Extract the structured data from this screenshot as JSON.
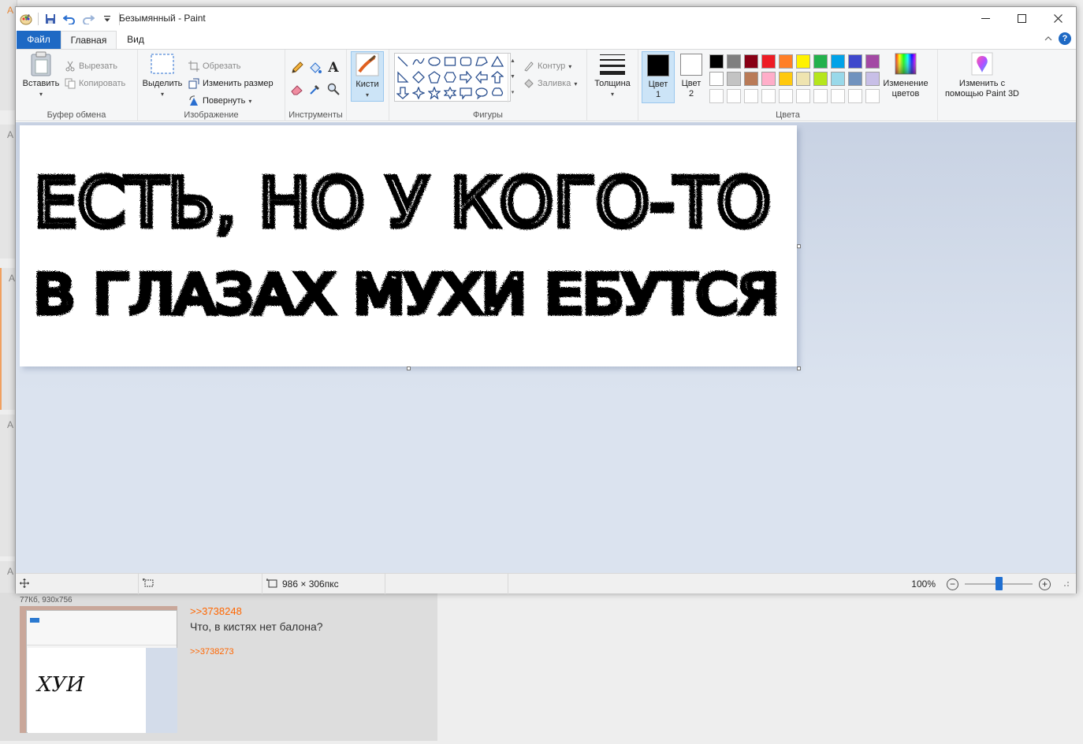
{
  "window": {
    "title": "Безымянный - Paint"
  },
  "tabs": {
    "file": "Файл",
    "home": "Главная",
    "view": "Вид"
  },
  "ribbon": {
    "clipboard": {
      "group": "Буфер обмена",
      "paste": "Вставить",
      "cut": "Вырезать",
      "copy": "Копировать"
    },
    "image": {
      "group": "Изображение",
      "select": "Выделить",
      "crop": "Обрезать",
      "resize": "Изменить размер",
      "rotate": "Повернуть"
    },
    "tools": {
      "group": "Инструменты",
      "text_tool": "A"
    },
    "brushes": {
      "label": "Кисти"
    },
    "shapes": {
      "group": "Фигуры",
      "outline": "Контур",
      "fill": "Заливка"
    },
    "size": {
      "label": "Толщина"
    },
    "colors": {
      "group": "Цвета",
      "color1_line1": "Цвет",
      "color1_line2": "1",
      "color2_line1": "Цвет",
      "color2_line2": "2",
      "color1_value": "#000000",
      "color2_value": "#ffffff",
      "edit_line1": "Изменение",
      "edit_line2": "цветов",
      "palette": [
        "#000000",
        "#7f7f7f",
        "#880015",
        "#ed1c24",
        "#ff7f27",
        "#fff200",
        "#22b14c",
        "#00a2e8",
        "#3f48cc",
        "#a349a4",
        "#ffffff",
        "#c3c3c3",
        "#b97a57",
        "#ffaec9",
        "#ffc90e",
        "#efe4b0",
        "#b5e61d",
        "#99d9ea",
        "#7092be",
        "#c8bfe7"
      ]
    },
    "paint3d": {
      "line1": "Изменить с",
      "line2": "помощью Paint 3D"
    }
  },
  "canvas": {
    "line1": "ЕСТЬ, НО У КОГО-ТО",
    "line2": "В ГЛАЗАХ МУХИ ЕБУТСЯ"
  },
  "status": {
    "image_size": "986 × 306пкс",
    "zoom": "100%",
    "zoom_level": 0.5
  },
  "background": {
    "meta": "77Кб, 930x756",
    "thumb_word": "ХУИ",
    "reply_link": ">>3738248",
    "post_text": "Что, в кистях нет балона?",
    "backlink": ">>3738273",
    "side_letter": "А"
  }
}
